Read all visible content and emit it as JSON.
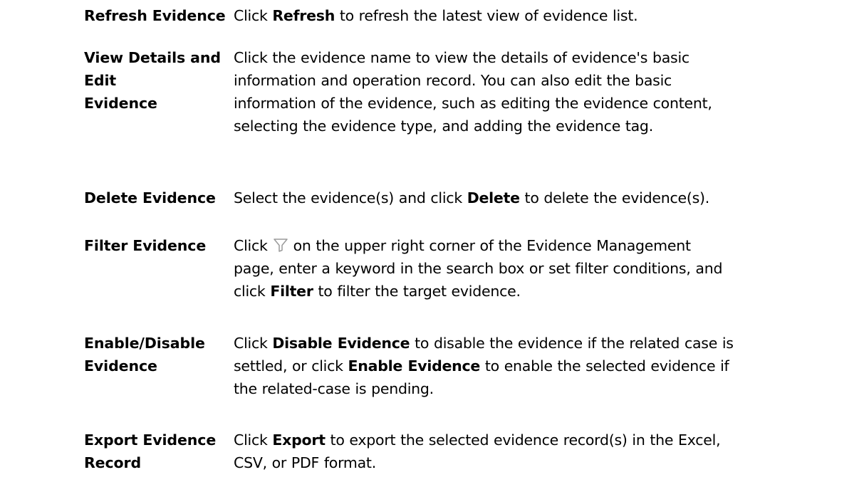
{
  "rows": [
    {
      "action": "Refresh Evidence",
      "segments": [
        {
          "t": "Click "
        },
        {
          "t": "Refresh",
          "b": true
        },
        {
          "t": " to refresh the latest view of evidence list."
        }
      ]
    },
    {
      "action": "View Details and Edit Evidence",
      "action_lines": [
        "View Details and Edit",
        "Evidence"
      ],
      "segments": [
        {
          "t": "Click the evidence name to view the details of evidence's basic"
        },
        {
          "br": true
        },
        {
          "t": "information and operation record. You can also edit the basic"
        },
        {
          "br": true
        },
        {
          "t": "information of the evidence, such as editing the evidence content,"
        },
        {
          "br": true
        },
        {
          "t": "selecting the evidence type, and adding the evidence tag."
        }
      ]
    },
    {
      "action": "Delete Evidence",
      "segments": [
        {
          "t": "Select the evidence(s) and click "
        },
        {
          "t": "Delete",
          "b": true
        },
        {
          "t": " to delete the evidence(s)."
        }
      ]
    },
    {
      "action": "Filter Evidence",
      "segments": [
        {
          "t": "Click"
        },
        {
          "icon": "filter-icon"
        },
        {
          "t": "on the upper right corner of the Evidence Management"
        },
        {
          "br": true
        },
        {
          "t": "page, enter a keyword in the search box or set filter conditions, and"
        },
        {
          "br": true
        },
        {
          "t": "click "
        },
        {
          "t": "Filter",
          "b": true
        },
        {
          "t": " to filter the target evidence."
        }
      ]
    },
    {
      "action": "Enable/Disable Evidence",
      "action_lines": [
        "Enable/Disable",
        "Evidence"
      ],
      "segments": [
        {
          "t": "Click "
        },
        {
          "t": "Disable Evidence",
          "b": true
        },
        {
          "t": " to disable the evidence if the related case is"
        },
        {
          "br": true
        },
        {
          "t": "settled, or click "
        },
        {
          "t": "Enable Evidence",
          "b": true
        },
        {
          "t": " to enable the selected evidence if"
        },
        {
          "br": true
        },
        {
          "t": "the related-case is pending."
        }
      ]
    },
    {
      "action": "Export Evidence Record",
      "action_lines": [
        "Export Evidence",
        "Record"
      ],
      "segments": [
        {
          "t": "Click "
        },
        {
          "t": "Export",
          "b": true
        },
        {
          "t": " to export the selected evidence record(s) in the Excel,"
        },
        {
          "br": true
        },
        {
          "t": "CSV, or PDF format."
        }
      ]
    }
  ],
  "icon_color": "#9a9a9a"
}
